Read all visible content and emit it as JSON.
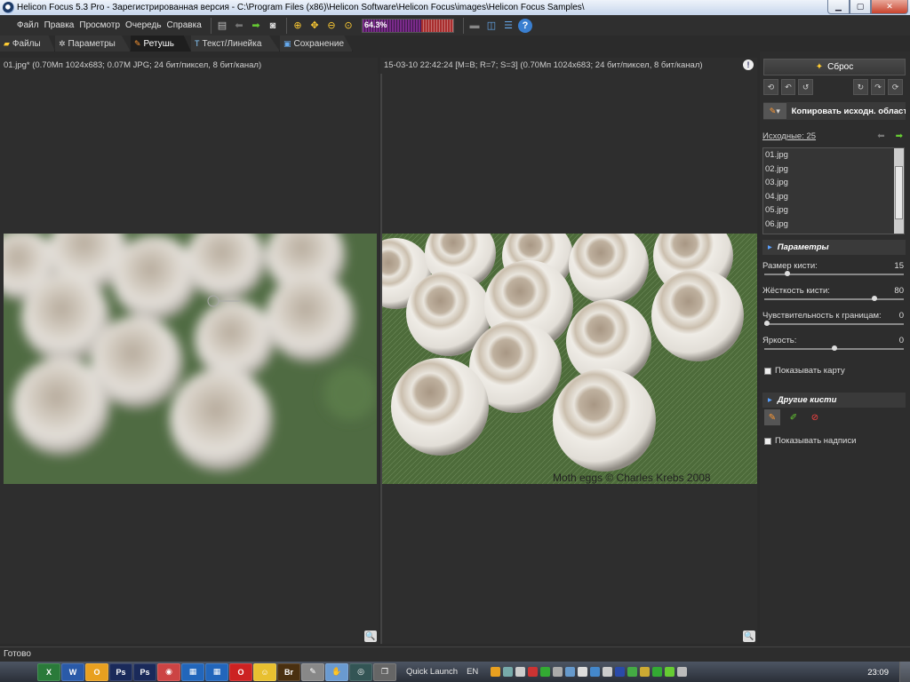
{
  "window": {
    "title": "Helicon Focus 5.3 Pro - Зарегистрированная версия - C:\\Program Files (x86)\\Helicon Software\\Helicon Focus\\images\\Helicon Focus Samples\\"
  },
  "menu": [
    "Файл",
    "Правка",
    "Просмотр",
    "Очередь",
    "Справка"
  ],
  "toolbar": {
    "progress_label": "64.3%",
    "progress_value": 0.643
  },
  "tabs": [
    {
      "label": "Файлы",
      "icon": "folder-icon"
    },
    {
      "label": "Параметры",
      "icon": "gear-icon"
    },
    {
      "label": "Ретушь",
      "icon": "brush-icon"
    },
    {
      "label": "Текст/Линейка",
      "icon": "text-icon"
    },
    {
      "label": "Сохранение",
      "icon": "save-icon"
    }
  ],
  "active_tab": "Ретушь",
  "left_panel": {
    "info": "01.jpg* (0.70Мп 1024x683; 0.07M JPG; 24 бит/пиксел, 8 бит/канал)"
  },
  "right_panel": {
    "info": "15-03-10 22:42:24 [M=B; R=7; S=3] (0.70Мп 1024x683; 24 бит/пиксел, 8 бит/канал)",
    "watermark": "Moth eggs © Charles Krebs 2008"
  },
  "sidebar": {
    "reset_label": "Сброс",
    "copy_label": "Копировать исходн. област",
    "sources_label": "Исходные: 25",
    "files": [
      "01.jpg",
      "02.jpg",
      "03.jpg",
      "04.jpg",
      "05.jpg",
      "06.jpg"
    ],
    "params_header": "Параметры",
    "params": [
      {
        "label": "Размер кисти:",
        "value": "15",
        "fraction": 0.15
      },
      {
        "label": "Жёсткость кисти:",
        "value": "80",
        "fraction": 0.8
      },
      {
        "label": "Чувствительность к границам:",
        "value": "0",
        "fraction": 0.0
      },
      {
        "label": "Яркость:",
        "value": "0",
        "fraction": 0.5
      }
    ],
    "show_map_label": "Показывать карту",
    "other_brushes_header": "Другие кисти",
    "show_labels_label": "Показывать надписи"
  },
  "status": {
    "text": "Готово"
  },
  "taskbar": {
    "quick_launch": "Quick Launch",
    "lang": "EN",
    "clock": "23:09"
  },
  "colors": {
    "background": "#2b2b2b",
    "accent_blue": "#5aa0ff",
    "leaf_green": "#4d6b3a",
    "egg": "#d9d3c8"
  }
}
